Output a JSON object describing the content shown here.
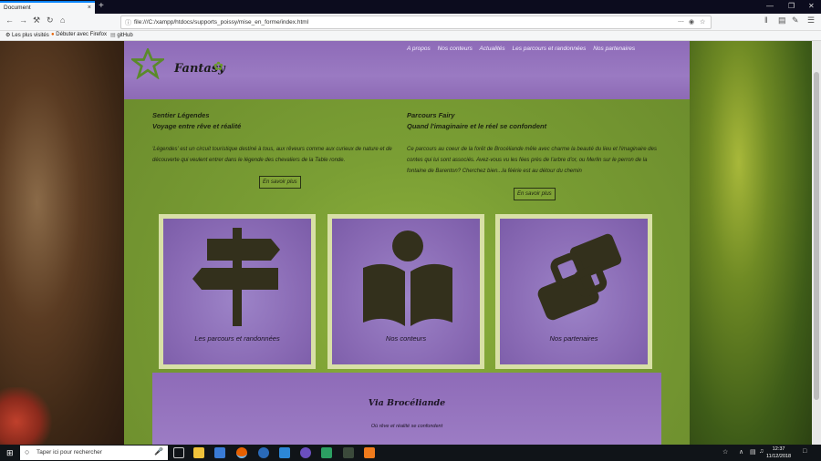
{
  "browser": {
    "tab_title": "Document",
    "tab_close": "×",
    "new_tab": "+",
    "url": "file:///C:/xampp/htdocs/supports_poissy/mise_en_forme/index.html",
    "bookmarks": [
      "Les plus visités",
      "Débuter avec Firefox",
      "gitHub"
    ]
  },
  "header": {
    "logo": "Fantasy",
    "nav": [
      "A propos",
      "Nos conteurs",
      "Actualités",
      "Les parcours et randonnées",
      "Nos partenaires"
    ]
  },
  "col_left": {
    "title": "Sentier Légendes",
    "subtitle": "Voyage entre rêve et réalité",
    "text": "'Légendes' est un circuit touristique destiné à tous, aux rêveurs comme aux curieux de nature et de découverte qui veulent entrer dans le légende des chevaliers de la Table ronde.",
    "button": "En savoir plus"
  },
  "col_right": {
    "title": "Parcours Fairy",
    "subtitle": "Quand l'imaginaire et le réel se confondent",
    "text": "Ce parcours au coeur de la forêt de Brocéliande mêle avec charme la beauté du lieu et l'imaginaire des contes qui lui sont associés. Avez-vous vu les fées près de l'arbre d'or, ou Merlin sur le perron de la fontaine de Barenton? Cherchez bien...la féérie est au détour du chemin",
    "button": "En savoir plus"
  },
  "cards": [
    {
      "label": "Les parcours et randonnées",
      "icon": "signpost-icon"
    },
    {
      "label": "Nos conteurs",
      "icon": "reader-icon"
    },
    {
      "label": "Nos partenaires",
      "icon": "handshake-icon"
    }
  ],
  "footer": {
    "title": "Via Brocéliande",
    "subtitle": "Où rêve et réalité se confondent"
  },
  "taskbar": {
    "search_placeholder": "Taper ici pour rechercher",
    "time": "12:37",
    "date": "11/12/2018"
  },
  "colors": {
    "purple": "#8e6bb8",
    "green": "#8fb33c",
    "card_border": "#d8e0a6"
  }
}
